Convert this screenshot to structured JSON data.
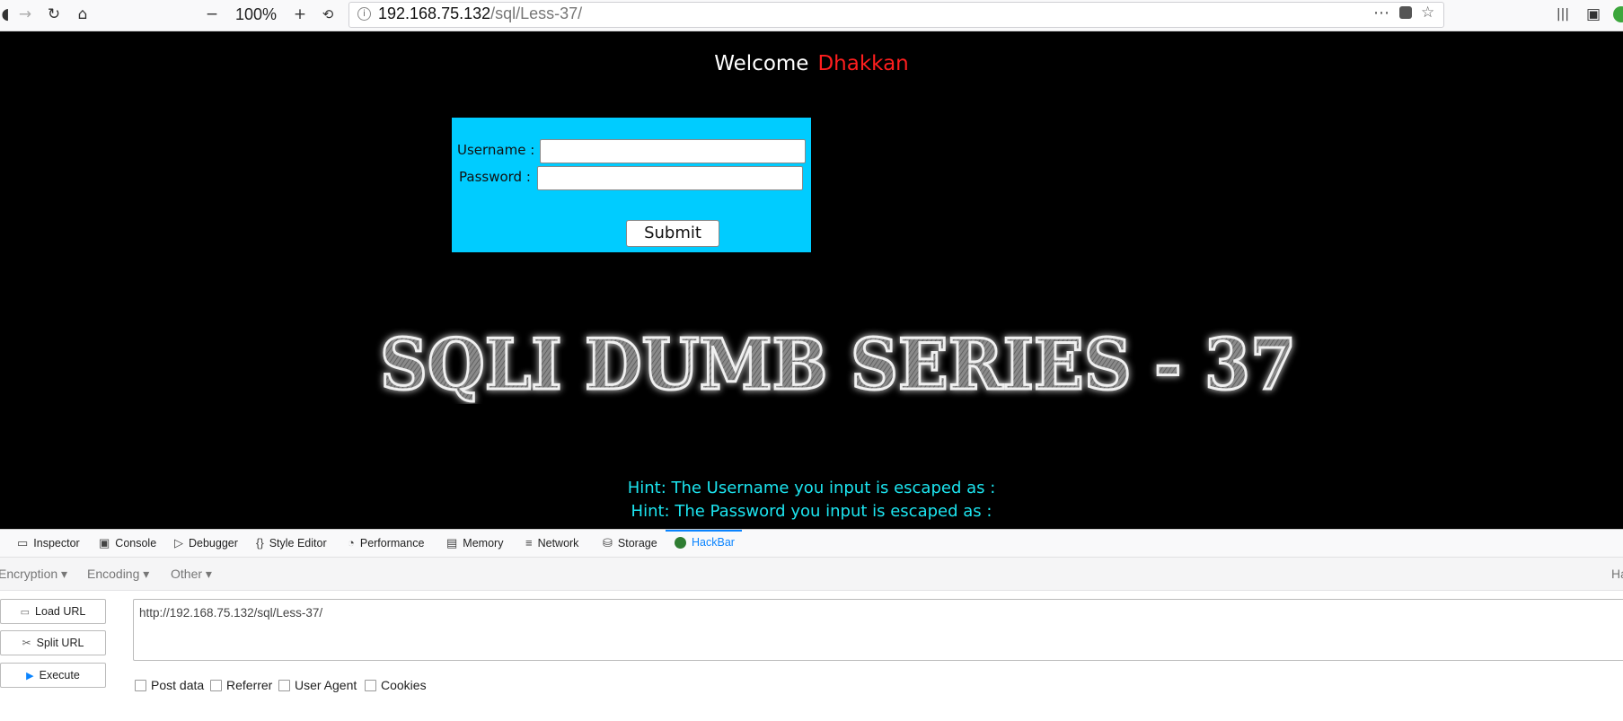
{
  "browser": {
    "zoom": "100%",
    "url_host": "192.168.75.132",
    "url_path": "/sql/Less-37/"
  },
  "page": {
    "welcome_text": "Welcome",
    "welcome_name": "Dhakkan",
    "form": {
      "username_label": "Username :",
      "password_label": "Password :",
      "submit_label": "Submit"
    },
    "banner_text": "SQLI DUMB SERIES - 37",
    "hint_username": "Hint: The Username you input is escaped as :",
    "hint_password": "Hint: The Password you input is escaped as :"
  },
  "devtools": {
    "tabs": [
      "Inspector",
      "Console",
      "Debugger",
      "Style Editor",
      "Performance",
      "Memory",
      "Network",
      "Storage",
      "HackBar"
    ],
    "active_tab": "HackBar",
    "hackbar": {
      "menus": [
        "Encryption",
        "Encoding",
        "Other"
      ],
      "right_menu_partial": "Ha",
      "buttons": [
        "Load URL",
        "Split URL",
        "Execute"
      ],
      "url_value": "http://192.168.75.132/sql/Less-37/",
      "checkboxes": [
        "Post data",
        "Referrer",
        "User Agent",
        "Cookies"
      ]
    }
  },
  "colors": {
    "page_bg": "#000000",
    "form_bg": "#00ccff",
    "welcome_name": "#ff1e1e",
    "hint": "#1ce4ef",
    "accent": "#0a84ff"
  }
}
